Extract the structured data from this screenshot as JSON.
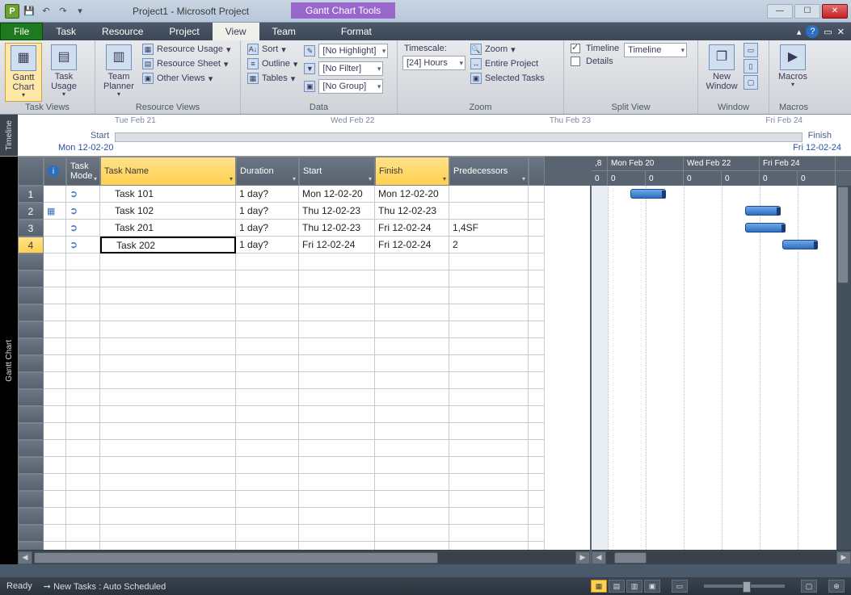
{
  "title": "Project1  -  Microsoft Project",
  "tools_tab": "Gantt Chart Tools",
  "menu": {
    "file": "File",
    "task": "Task",
    "resource": "Resource",
    "project": "Project",
    "view": "View",
    "team": "Team",
    "format": "Format"
  },
  "ribbon": {
    "task_views": {
      "label": "Task Views",
      "gantt": "Gantt Chart",
      "task_usage": "Task Usage"
    },
    "resource_views": {
      "label": "Resource Views",
      "team_planner": "Team Planner",
      "resource_usage": "Resource Usage",
      "resource_sheet": "Resource Sheet",
      "other_views": "Other Views"
    },
    "data": {
      "label": "Data",
      "sort": "Sort",
      "outline": "Outline",
      "tables": "Tables",
      "highlight": "[No Highlight]",
      "filter": "[No Filter]",
      "group": "[No Group]"
    },
    "zoom": {
      "label": "Zoom",
      "timescale_lbl": "Timescale:",
      "timescale_val": "[24] Hours",
      "zoom_btn": "Zoom",
      "entire": "Entire Project",
      "selected": "Selected Tasks"
    },
    "split": {
      "label": "Split View",
      "timeline_chk": "Timeline",
      "timeline_val": "Timeline",
      "details_chk": "Details"
    },
    "window": {
      "label": "Window",
      "new_window": "New Window"
    },
    "macros": {
      "label": "Macros",
      "macros_btn": "Macros"
    }
  },
  "timeline": {
    "side": "Timeline",
    "dates": [
      "Tue Feb 21",
      "Wed Feb 22",
      "Thu Feb 23",
      "Fri Feb 24"
    ],
    "start_lbl": "Start",
    "finish_lbl": "Finish",
    "start_date": "Mon 12-02-20",
    "finish_date": "Fri 12-02-24"
  },
  "gc_side": "Gantt Chart",
  "columns": {
    "info": "ℹ",
    "mode": "Task Mode",
    "name": "Task Name",
    "duration": "Duration",
    "start": "Start",
    "finish": "Finish",
    "pred": "Predecessors"
  },
  "rows": [
    {
      "n": "1",
      "ind": "",
      "name": "Task 101",
      "dur": "1 day?",
      "start": "Mon 12-02-20",
      "finish": "Mon 12-02-20",
      "pred": ""
    },
    {
      "n": "2",
      "ind": "grid",
      "name": "Task 102",
      "dur": "1 day?",
      "start": "Thu 12-02-23",
      "finish": "Thu 12-02-23",
      "pred": ""
    },
    {
      "n": "3",
      "ind": "",
      "name": "Task 201",
      "dur": "1 day?",
      "start": "Thu 12-02-23",
      "finish": "Fri 12-02-24",
      "pred": "1,4SF"
    },
    {
      "n": "4",
      "ind": "",
      "name": "Task 202",
      "dur": "1 day?",
      "start": "Fri 12-02-24",
      "finish": "Fri 12-02-24",
      "pred": "2"
    }
  ],
  "selected_row": 3,
  "gantt_hdr_top": [
    ",8",
    "Mon Feb 20",
    "Wed Feb 22",
    "Fri Feb 24"
  ],
  "gantt_hdr_bot": [
    "0",
    "0",
    "0",
    "0",
    "0",
    "0",
    "0"
  ],
  "status": {
    "ready": "Ready",
    "newtasks": "New Tasks : Auto Scheduled"
  },
  "chart_data": {
    "type": "gantt",
    "time_axis": {
      "start": "2012-02-18",
      "end": "2012-02-25",
      "major_ticks": [
        "Mon Feb 20",
        "Wed Feb 22",
        "Fri Feb 24"
      ],
      "minor_tick_label": "0"
    },
    "tasks": [
      {
        "id": 1,
        "name": "Task 101",
        "start": "2012-02-20",
        "finish": "2012-02-20",
        "duration_days": 1,
        "predecessors": []
      },
      {
        "id": 2,
        "name": "Task 102",
        "start": "2012-02-23",
        "finish": "2012-02-23",
        "duration_days": 1,
        "predecessors": []
      },
      {
        "id": 3,
        "name": "Task 201",
        "start": "2012-02-23",
        "finish": "2012-02-24",
        "duration_days": 1,
        "predecessors": [
          "1",
          "4SF"
        ]
      },
      {
        "id": 4,
        "name": "Task 202",
        "start": "2012-02-24",
        "finish": "2012-02-24",
        "duration_days": 1,
        "predecessors": [
          "2"
        ]
      }
    ]
  }
}
